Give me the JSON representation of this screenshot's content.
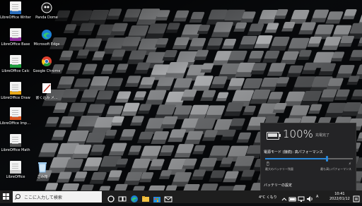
{
  "desktop": {
    "icons": [
      {
        "label": "LibreOffice Writer",
        "icon": "writer-icon",
        "color": "#2a6ebd"
      },
      {
        "label": "Panda Dome",
        "icon": "panda-dome-icon",
        "color": "#111111"
      },
      {
        "label": "LibreOffice Base",
        "icon": "base-icon",
        "color": "#8e2b9e"
      },
      {
        "label": "Microsoft Edge",
        "icon": "edge-icon",
        "color": "#1a7fd4"
      },
      {
        "label": "LibreOffice Calc",
        "icon": "calc-icon",
        "color": "#1e9e3e"
      },
      {
        "label": "Google Chrome",
        "icon": "chrome-icon",
        "color": "#e0412f"
      },
      {
        "label": "LibreOffice Draw",
        "icon": "draw-icon",
        "color": "#e6a719"
      },
      {
        "label": "書く込み メ...",
        "icon": "notepad-icon",
        "color": "#ffffff"
      },
      {
        "label": "LibreOffice Impress",
        "icon": "impress-icon",
        "color": "#d9541e"
      },
      {
        "label": "LibreOffice Math",
        "icon": "math-icon",
        "color": "#555555"
      },
      {
        "label": "LibreOffice",
        "icon": "libreoffice-icon",
        "color": "#cccccc"
      },
      {
        "label": "ごみ箱",
        "icon": "recycle-bin-icon",
        "color": "#7fb6e6"
      }
    ]
  },
  "battery_flyout": {
    "percent": "100%",
    "status": "充電完了",
    "mode_label": "電源モード (接続): 高パフォーマンス",
    "slider_value": 0.7,
    "left_end": "最大のバッテリー残量",
    "right_end": "最も高いパフォーマンス",
    "settings_link": "バッテリーの設定"
  },
  "taskbar": {
    "search_placeholder": "ここに入力して検索",
    "weather": "4°C くもり",
    "ime": "A",
    "time": "10:41",
    "date": "2022/01/12",
    "accent": "#2b88d8"
  }
}
